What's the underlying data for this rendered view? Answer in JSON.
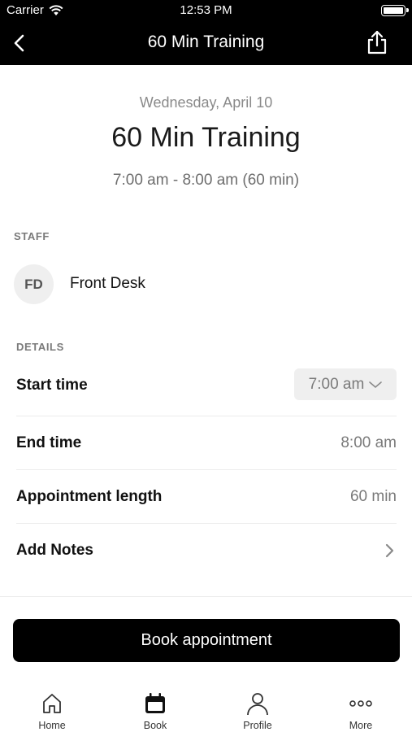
{
  "status_bar": {
    "carrier": "Carrier",
    "time": "12:53 PM"
  },
  "nav": {
    "title": "60 Min Training",
    "back_icon": "chevron-left-icon",
    "share_icon": "share-icon"
  },
  "header": {
    "date": "Wednesday, April 10",
    "title": "60 Min Training",
    "time_range": "7:00 am - 8:00 am (60 min)"
  },
  "staff": {
    "section_label": "STAFF",
    "initials": "FD",
    "name": "Front Desk"
  },
  "details": {
    "section_label": "DETAILS",
    "start_time": {
      "label": "Start time",
      "value": "7:00 am"
    },
    "end_time": {
      "label": "End time",
      "value": "8:00 am"
    },
    "length": {
      "label": "Appointment length",
      "value": "60 min"
    },
    "notes": {
      "label": "Add Notes"
    }
  },
  "cta": {
    "book_label": "Book appointment"
  },
  "tabs": [
    {
      "label": "Home",
      "icon": "home-icon"
    },
    {
      "label": "Book",
      "icon": "calendar-icon",
      "selected": true
    },
    {
      "label": "Profile",
      "icon": "person-icon"
    },
    {
      "label": "More",
      "icon": "more-icon"
    }
  ],
  "colors": {
    "bar": "#000000",
    "muted_text": "#7a7a7a",
    "chip_bg": "#efefef",
    "divider": "#ececec"
  }
}
